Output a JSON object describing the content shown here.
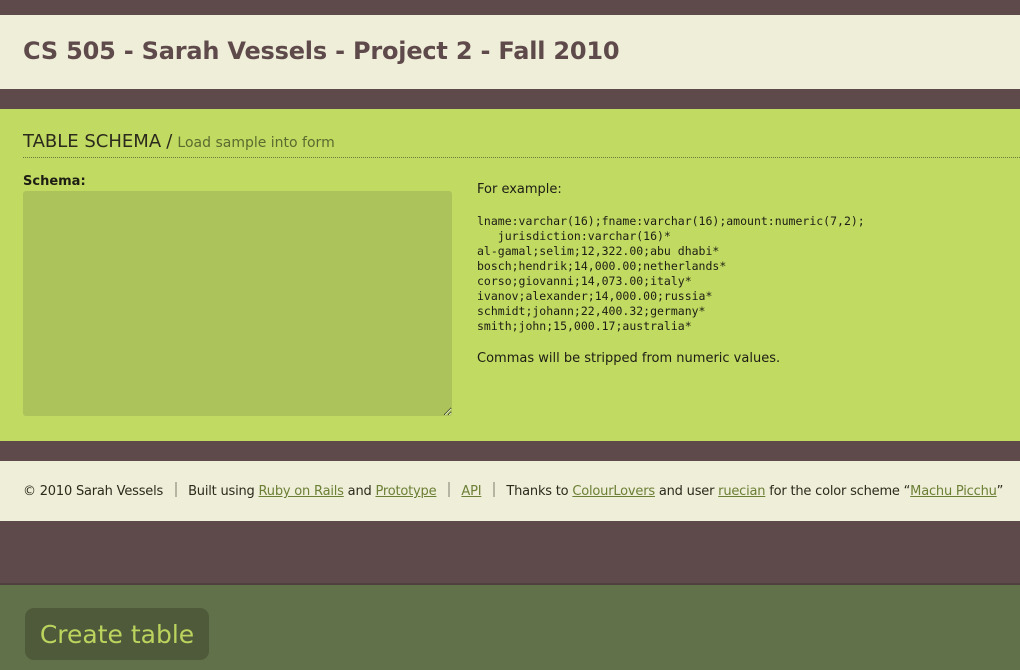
{
  "header": {
    "title": "CS 505 - Sarah Vessels - Project 2 - Fall 2010"
  },
  "section": {
    "title": "TABLE SCHEMA",
    "separator": "/",
    "load_link": "Load sample into form"
  },
  "schema": {
    "label": "Schema:",
    "value": ""
  },
  "example": {
    "intro": "For example:",
    "code_lines": [
      "lname:varchar(16);fname:varchar(16);amount:numeric(7,2);",
      "   jurisdiction:varchar(16)*",
      "al-gamal;selim;12,322.00;abu dhabi*",
      "bosch;hendrik;14,000.00;netherlands*",
      "corso;giovanni;14,073.00;italy*",
      "ivanov;alexander;14,000.00;russia*",
      "schmidt;johann;22,400.32;germany*",
      "smith;john;15,000.17;australia*"
    ],
    "note": "Commas will be stripped from numeric values."
  },
  "footer": {
    "copyright": "© 2010 Sarah Vessels",
    "built_using": "Built using",
    "rails_link": "Ruby on Rails",
    "and": "and",
    "prototype_link": "Prototype",
    "api_link": "API",
    "thanks_to": "Thanks to",
    "colourlovers_link": "ColourLovers",
    "and_user": "and user",
    "user_link": "ruecian",
    "color_scheme_text": "for the color scheme “",
    "scheme_link": "Machu Picchu",
    "closing_quote": "”"
  },
  "action": {
    "create_label": "Create table"
  },
  "colors": {
    "brown": "#5f4a4b",
    "cream": "#efeed9",
    "lime": "#c1da62",
    "olive": "#61714a",
    "button": "#4f5a3b",
    "link": "#6b7f35"
  },
  "icons": {
    "resize_grip": "resize-grip-icon"
  }
}
